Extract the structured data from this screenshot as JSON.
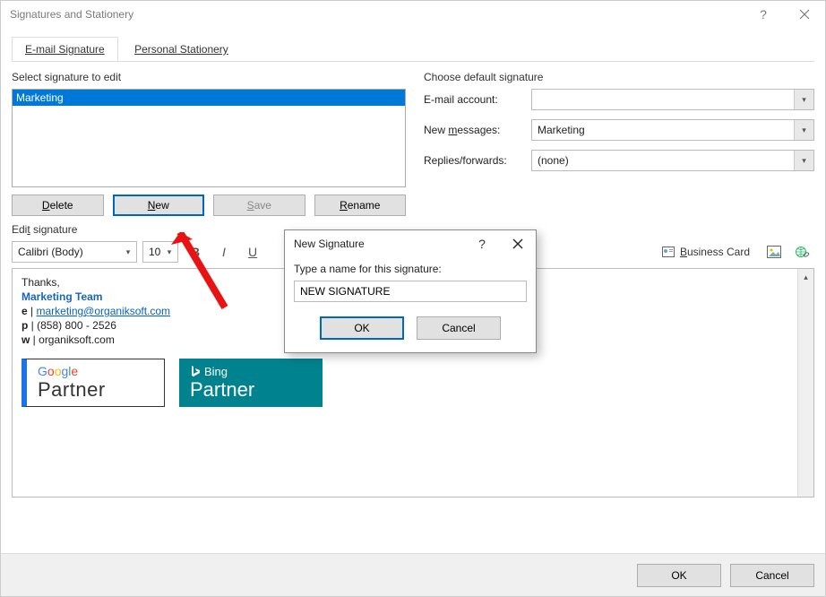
{
  "window": {
    "title": "Signatures and Stationery"
  },
  "tabs": {
    "email": "E-mail Signature",
    "stationery": "Personal Stationery"
  },
  "select_label": "Select signature to edit",
  "signature_list": [
    "Marketing"
  ],
  "buttons": {
    "delete": "Delete",
    "new": "New",
    "save": "Save",
    "rename": "Rename"
  },
  "defaults": {
    "section_label": "Choose default signature",
    "email_account_label": "E-mail account:",
    "email_account_value": "",
    "new_messages_label": "New messages:",
    "new_messages_value": "Marketing",
    "replies_label": "Replies/forwards:",
    "replies_value": "(none)"
  },
  "edit_label": "Edit signature",
  "toolbar": {
    "font": "Calibri (Body)",
    "size": "10",
    "business_card": "Business Card"
  },
  "signature_body": {
    "thanks": "Thanks,",
    "team": "Marketing Team",
    "e_label": "e",
    "e_value": "marketing@organiksoft.com",
    "p_label": "p",
    "p_value": "(858) 800 - 2526",
    "w_label": "w",
    "w_value": "organiksoft.com",
    "google_partner": "Partner",
    "bing_label": "Bing",
    "bing_partner": "Partner"
  },
  "footer": {
    "ok": "OK",
    "cancel": "Cancel"
  },
  "popup": {
    "title": "New Signature",
    "prompt": "Type a name for this signature:",
    "value": "NEW SIGNATURE",
    "ok": "OK",
    "cancel": "Cancel"
  }
}
